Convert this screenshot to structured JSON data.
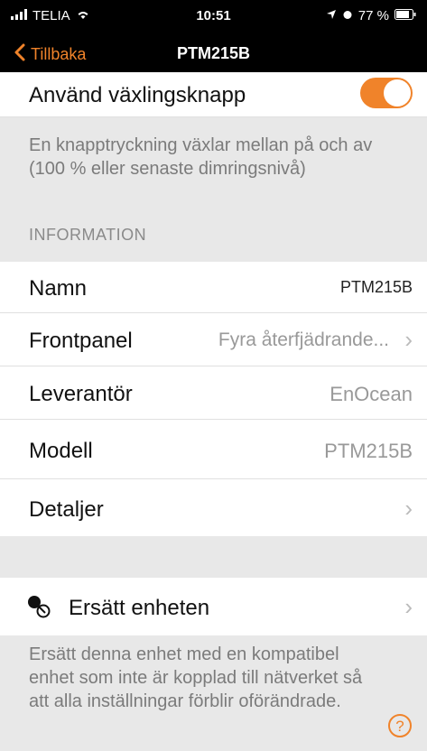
{
  "status_bar": {
    "carrier": "TELIA",
    "time": "10:51",
    "battery": "77 %"
  },
  "nav": {
    "back_label": "Tillbaka",
    "title": "PTM215B"
  },
  "toggle_row": {
    "label": "Använd växlingsknapp",
    "enabled": true,
    "accent_color": "#f0832a"
  },
  "toggle_note": "En knapptryckning växlar mellan på och av (100 % eller senaste dimringsnivå)",
  "info_section": {
    "header": "INFORMATION",
    "rows": [
      {
        "label": "Namn",
        "value": "PTM215B"
      },
      {
        "label": "Frontpanel",
        "value": "Fyra återfjädrande..."
      },
      {
        "label": "Leverantör",
        "value": "EnOcean"
      },
      {
        "label": "Modell",
        "value": "PTM215B"
      },
      {
        "label": "Detaljer",
        "value": ""
      }
    ]
  },
  "replace": {
    "label": "Ersätt enheten",
    "note": "Ersätt denna enhet med en kompatibel enhet som inte är kopplad till nätverket så att alla inställningar förblir oförändrade."
  }
}
